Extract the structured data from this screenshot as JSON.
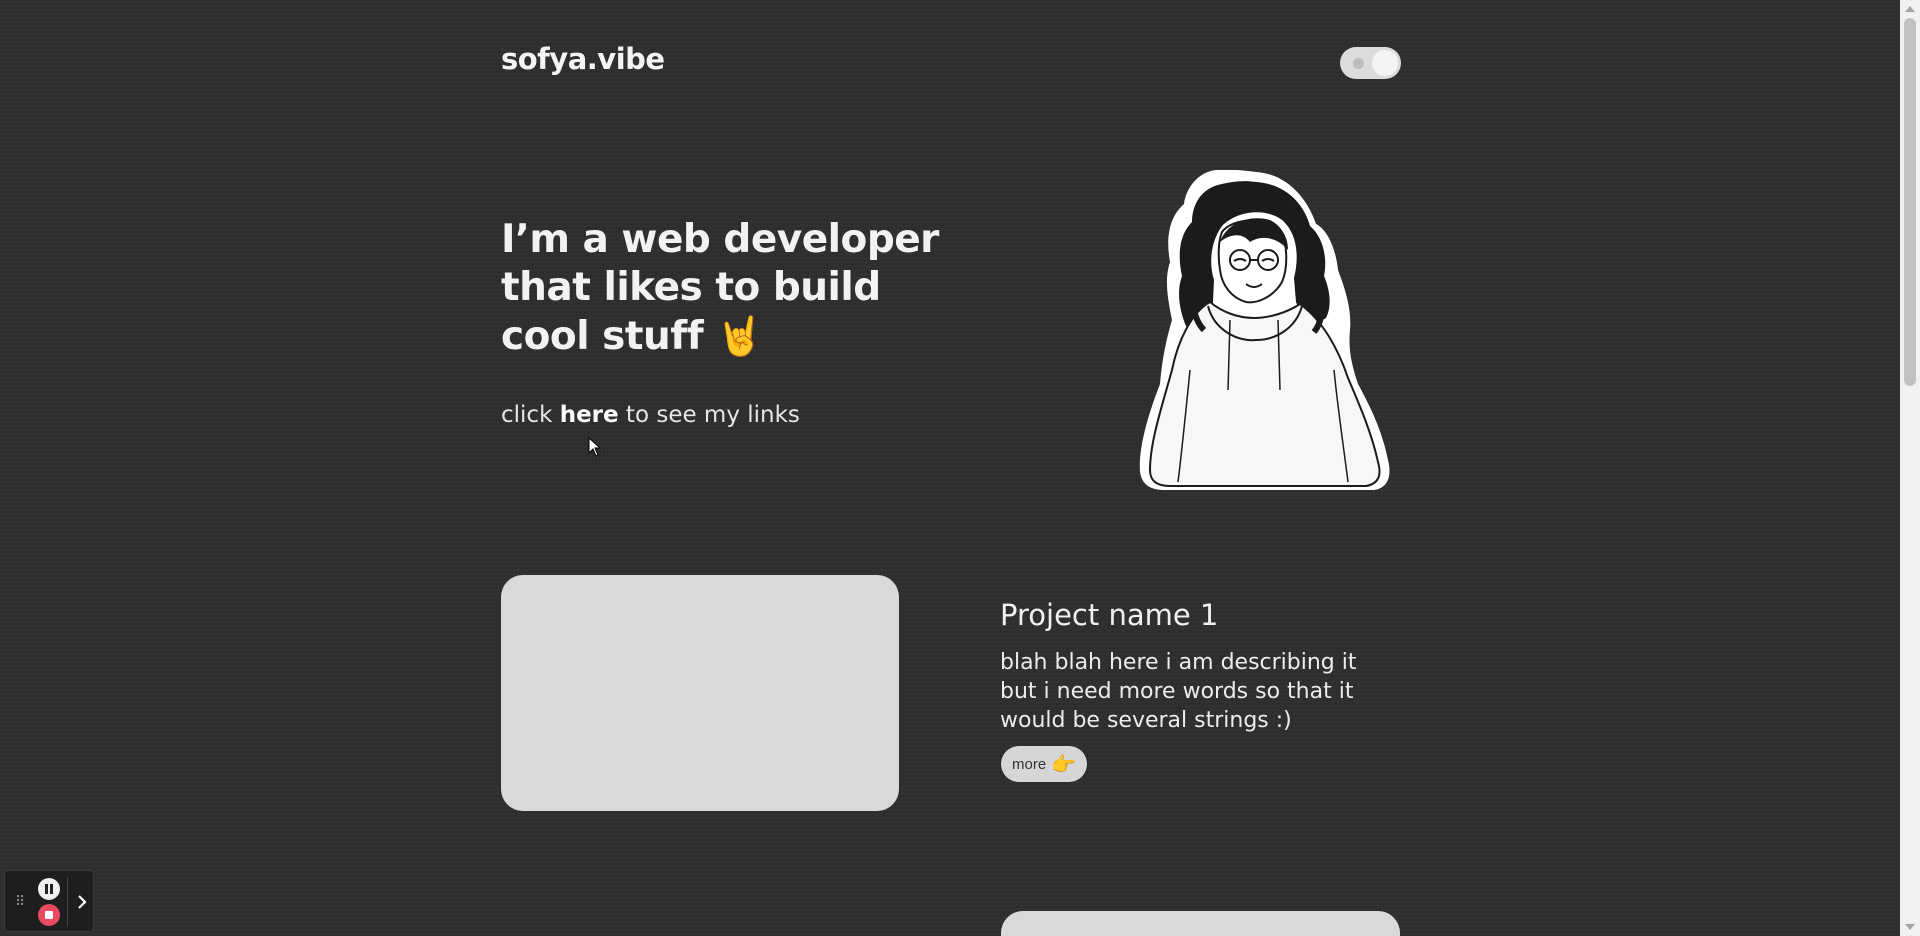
{
  "header": {
    "logo": "sofya.vibe",
    "theme_toggle_icon": "moon-icon"
  },
  "hero": {
    "title_line1": "I’m a web developer",
    "title_line2": "that likes to build",
    "title_line3": "cool stuff",
    "title_emoji": "🤘",
    "links_prefix": "click ",
    "links_here": "here",
    "links_suffix": " to see my links"
  },
  "projects": [
    {
      "title": "Project name 1",
      "description": "blah blah here i am describing it but i need more words so that it would be several strings :)",
      "more_label": "more",
      "more_emoji": "👉"
    }
  ],
  "colors": {
    "background": "#2e2e2e",
    "text": "#f2f2f2",
    "card": "#d9d9d9",
    "recorder_stop": "#e84a5f"
  }
}
